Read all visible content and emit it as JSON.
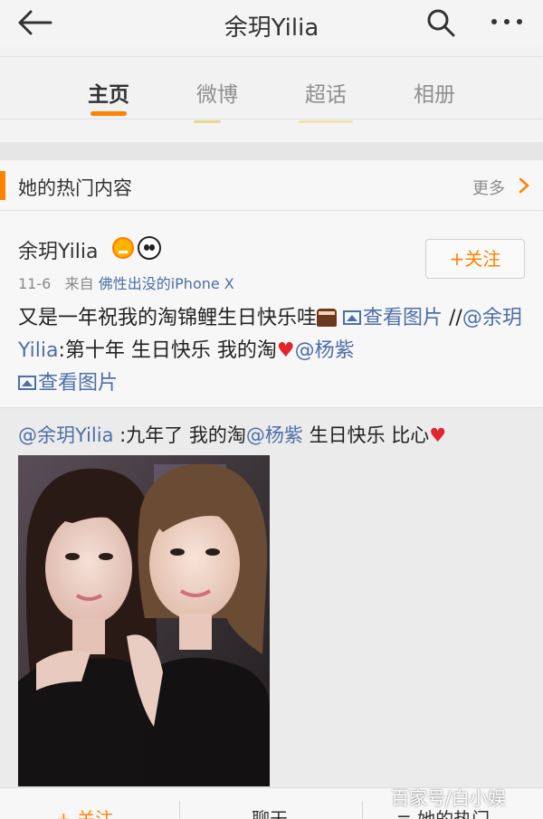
{
  "header": {
    "title": "余玥Yilia"
  },
  "tabs": [
    {
      "label": "主页",
      "active": true
    },
    {
      "label": "微博",
      "active": false
    },
    {
      "label": "超话",
      "active": false
    },
    {
      "label": "相册",
      "active": false
    }
  ],
  "hot_section": {
    "label": "她的热门内容",
    "more_label": "更多"
  },
  "post": {
    "author": "余玥Yilia",
    "date": "11-6",
    "from_prefix": "来自",
    "source": "佛性出没的iPhone X",
    "follow_label": "+关注",
    "text_1": "又是一年祝我的淘锦鲤生日快乐哇",
    "view_pic_1": "查看图片",
    "repost_sep": " //",
    "mention_1": "@余玥Yilia",
    "text_2": ":第十年 生日快乐 我的淘",
    "mention_2": "@杨紫",
    "view_pic_2": "查看图片"
  },
  "repost": {
    "mention_author": "@余玥Yilia",
    "text_1": " :九年了 我的淘",
    "mention_2": "@杨紫",
    "text_2": " 生日快乐 比心"
  },
  "bottom_bar": {
    "follow_label": "+ 关注",
    "chat_label": "聊天",
    "hot_label": "≡ 她的热门"
  },
  "watermark": "百家号/白小娱",
  "colors": {
    "accent": "#ff8200",
    "link": "#4d6fa7",
    "heart": "#e0262c"
  }
}
